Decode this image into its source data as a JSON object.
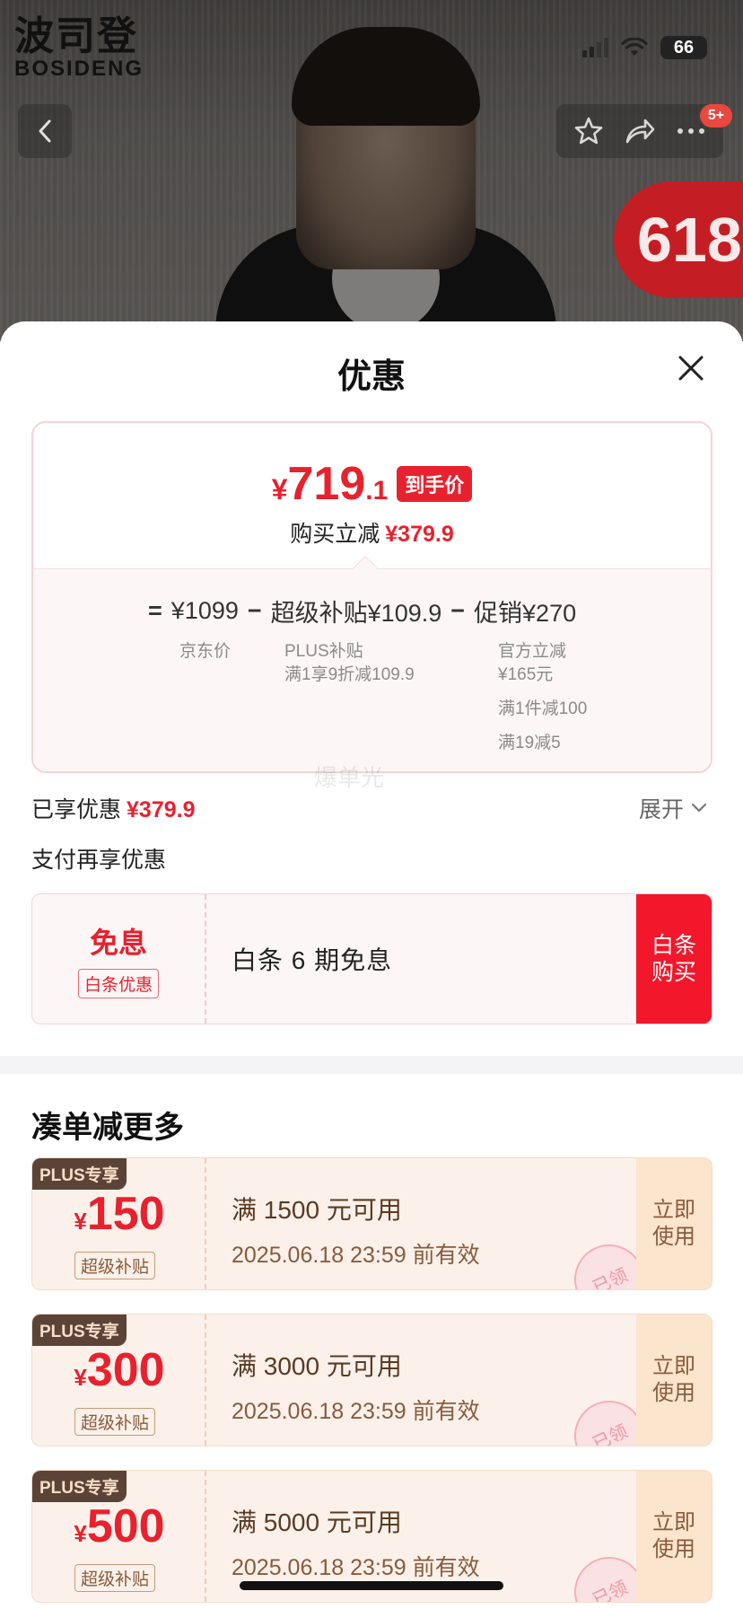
{
  "status_bar": {
    "battery": "66"
  },
  "brand": {
    "cn": "波司登",
    "en": "BOSIDENG"
  },
  "hero": {
    "badge_count": "5+",
    "promo_badge": "618"
  },
  "sheet": {
    "title": "优惠"
  },
  "price": {
    "yen": "¥",
    "int_part": "719",
    "dec_part": ".1",
    "tag": "到手价",
    "reduce_label": "购买立减",
    "reduce_value": "¥379.9"
  },
  "formula": {
    "eq": "=",
    "base_price": "¥1099",
    "minus": "−",
    "subsidy": "超级补贴¥109.9",
    "promo": "促销¥270",
    "base_label": "京东价",
    "subsidy_line1": "PLUS补贴",
    "subsidy_line2": "满1享9折减109.9",
    "promo_line1": "官方立减",
    "promo_line2": "¥165元",
    "promo_line3": "满1件减100",
    "promo_line4": "满19减5"
  },
  "watermark": "爆单光",
  "enjoyed": {
    "label": "已享优惠",
    "value": "¥379.9",
    "expand": "展开"
  },
  "pay_more": "支付再享优惠",
  "baitiao": {
    "free": "免息",
    "chip": "白条优惠",
    "desc": "白条 6 期免息",
    "buy": "白条\n购买"
  },
  "more_title": "凑单减更多",
  "coupons": [
    {
      "plus": "PLUS专享",
      "yen": "¥",
      "amount": "150",
      "chip": "超级补贴",
      "cond": "满 1500 元可用",
      "valid": "2025.06.18 23:59 前有效",
      "use": "立即\n使用",
      "stamp": "已领"
    },
    {
      "plus": "PLUS专享",
      "yen": "¥",
      "amount": "300",
      "chip": "超级补贴",
      "cond": "满 3000 元可用",
      "valid": "2025.06.18 23:59 前有效",
      "use": "立即\n使用",
      "stamp": "已领"
    },
    {
      "plus": "PLUS专享",
      "yen": "¥",
      "amount": "500",
      "chip": "超级补贴",
      "cond": "满 5000 元可用",
      "valid": "2025.06.18 23:59 前有效",
      "use": "立即\n使用",
      "stamp": "已领"
    }
  ],
  "colors": {
    "accent_red": "#e8212e",
    "plus_brown": "#5b4437",
    "coupon_bg": "#fbf1ea"
  }
}
